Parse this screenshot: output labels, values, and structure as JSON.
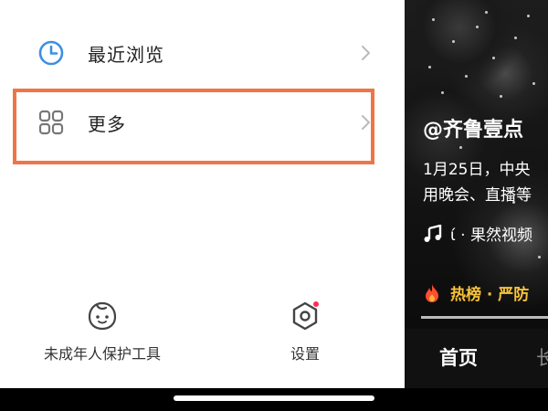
{
  "drawer": {
    "recent_label": "最近浏览",
    "more_label": "更多",
    "minor_tool_label": "未成年人保护工具",
    "settings_label": "设置",
    "icons": {
      "recent": "clock-icon",
      "more": "grid-icon",
      "minor_tool": "child-face-icon",
      "settings": "settings-hexagon-icon",
      "chevron": "chevron-right-icon"
    }
  },
  "video": {
    "author": "@齐鲁壹点",
    "desc_line1": "1月25日，中央",
    "desc_line2": "用晚会、直播等",
    "music": "ί · 果然视频",
    "hot": "热榜 · 严防",
    "nav_home": "首页",
    "nav_next": "长"
  },
  "colors": {
    "highlight": "#ee7547",
    "accent_blue": "#3d8fe0",
    "hot_yellow": "#f7c23a",
    "notification_red": "#ff2b54"
  }
}
